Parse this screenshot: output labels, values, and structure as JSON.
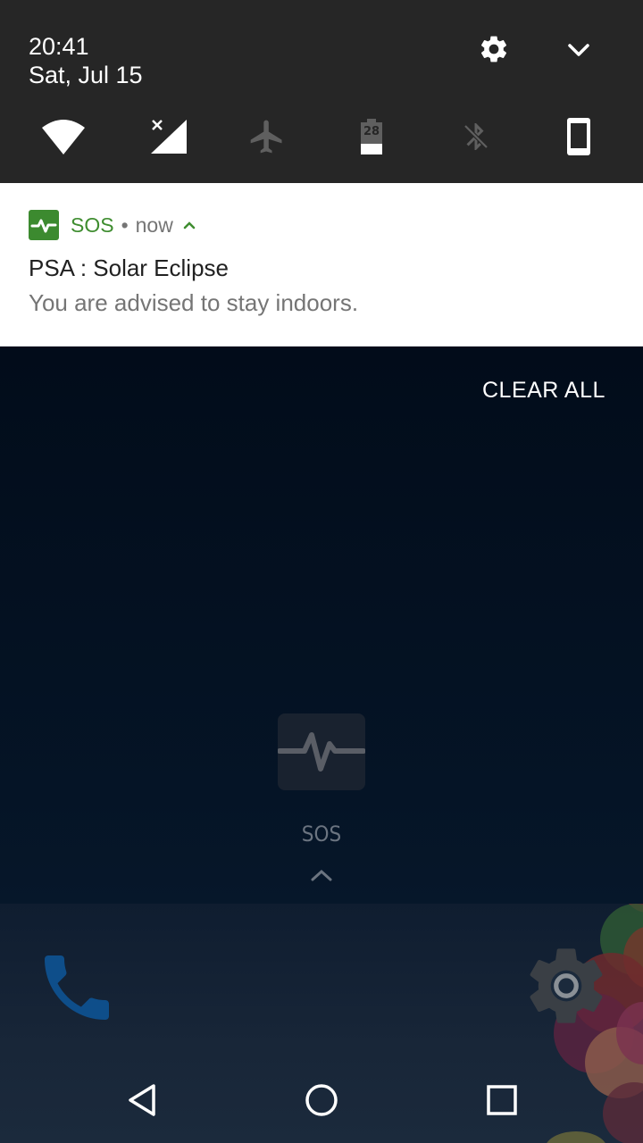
{
  "status_header": {
    "time": "20:41",
    "date": "Sat, Jul 15",
    "settings_icon": "gear-icon",
    "expand_icon": "chevron-down-icon"
  },
  "quick_tiles": [
    {
      "name": "wifi",
      "icon": "wifi-icon",
      "state": "on"
    },
    {
      "name": "cellular",
      "icon": "cell-signal-no-sim-icon",
      "state": "on"
    },
    {
      "name": "airplane-mode",
      "icon": "airplane-icon",
      "state": "off"
    },
    {
      "name": "battery",
      "icon": "battery-icon",
      "level_label": "28",
      "state": "on"
    },
    {
      "name": "bluetooth",
      "icon": "bluetooth-icon",
      "state": "off"
    },
    {
      "name": "device",
      "icon": "phone-device-icon",
      "state": "on"
    }
  ],
  "notification": {
    "app_name": "SOS",
    "separator": "•",
    "time": "now",
    "title": "PSA : Solar Eclipse",
    "text": "You are advised to stay indoors.",
    "accent_color": "#3f8d30"
  },
  "clear_all_label": "CLEAR ALL",
  "home": {
    "app_label": "SOS",
    "app_icon": "pulse-icon"
  },
  "dock": {
    "left_icon": "phone-icon",
    "right_icon": "settings-icon"
  },
  "nav": {
    "back_icon": "back-triangle-icon",
    "home_icon": "home-circle-icon",
    "recents_icon": "recents-square-icon"
  },
  "colors": {
    "header_bg": "#262626",
    "card_bg": "#ffffff",
    "shade_bg": "#03101f"
  }
}
